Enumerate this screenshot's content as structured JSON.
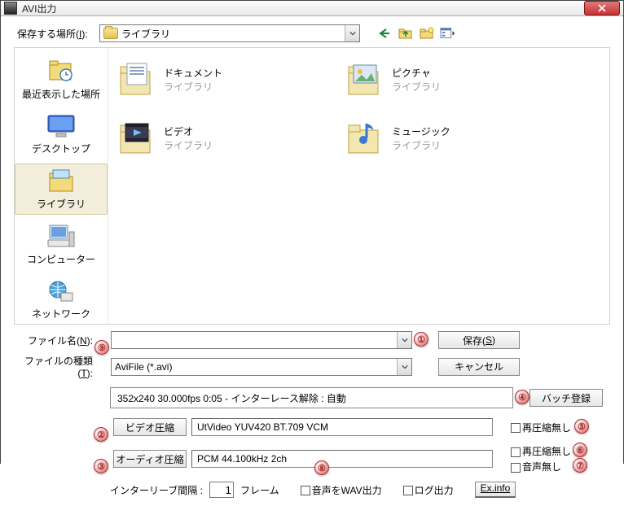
{
  "title": "AVI出力",
  "toprow": {
    "label_pre": "保存する場所(",
    "label_key": "I",
    "label_post": "):",
    "location": "ライブラリ"
  },
  "sidebar": [
    {
      "label": "最近表示した場所"
    },
    {
      "label": "デスクトップ"
    },
    {
      "label": "ライブラリ"
    },
    {
      "label": "コンピューター"
    },
    {
      "label": "ネットワーク"
    }
  ],
  "files": [
    {
      "name": "ドキュメント",
      "sub": "ライブラリ"
    },
    {
      "name": "ピクチャ",
      "sub": "ライブラリ"
    },
    {
      "name": "ビデオ",
      "sub": "ライブラリ"
    },
    {
      "name": "ミュージック",
      "sub": "ライブラリ"
    }
  ],
  "filename": {
    "label_pre": "ファイル名(",
    "label_key": "N",
    "label_post": "):",
    "value": ""
  },
  "filetype": {
    "label_pre": "ファイルの種類(",
    "label_key": "T",
    "label_post": "):",
    "value": "AviFile (*.avi)"
  },
  "buttons": {
    "save_pre": "保存(",
    "save_key": "S",
    "save_post": ")",
    "cancel": "キャンセル",
    "batch": "バッチ登録",
    "video": "ビデオ圧縮",
    "audio": "オーディオ圧縮",
    "exinfo": "Ex.info"
  },
  "info": "352x240  30.000fps  0:05  -  インターレース解除 : 自動",
  "video_codec": "UtVideo YUV420 BT.709 VCM",
  "audio_codec": "PCM 44.100kHz 2ch",
  "checks": {
    "recomp1": "再圧縮無し",
    "recomp2": "再圧縮無し",
    "noaudio": "音声無し",
    "wav": "音声をWAV出力",
    "log": "ログ出力"
  },
  "interleave": {
    "label": "インターリーブ間隔 :",
    "value": "1",
    "unit": "フレーム"
  },
  "ann": {
    "a1": "①",
    "a2": "②",
    "a3": "③",
    "a4": "④",
    "a5": "⑤",
    "a6": "⑥",
    "a7": "⑦",
    "a8": "⑧",
    "a9": "⑨"
  }
}
